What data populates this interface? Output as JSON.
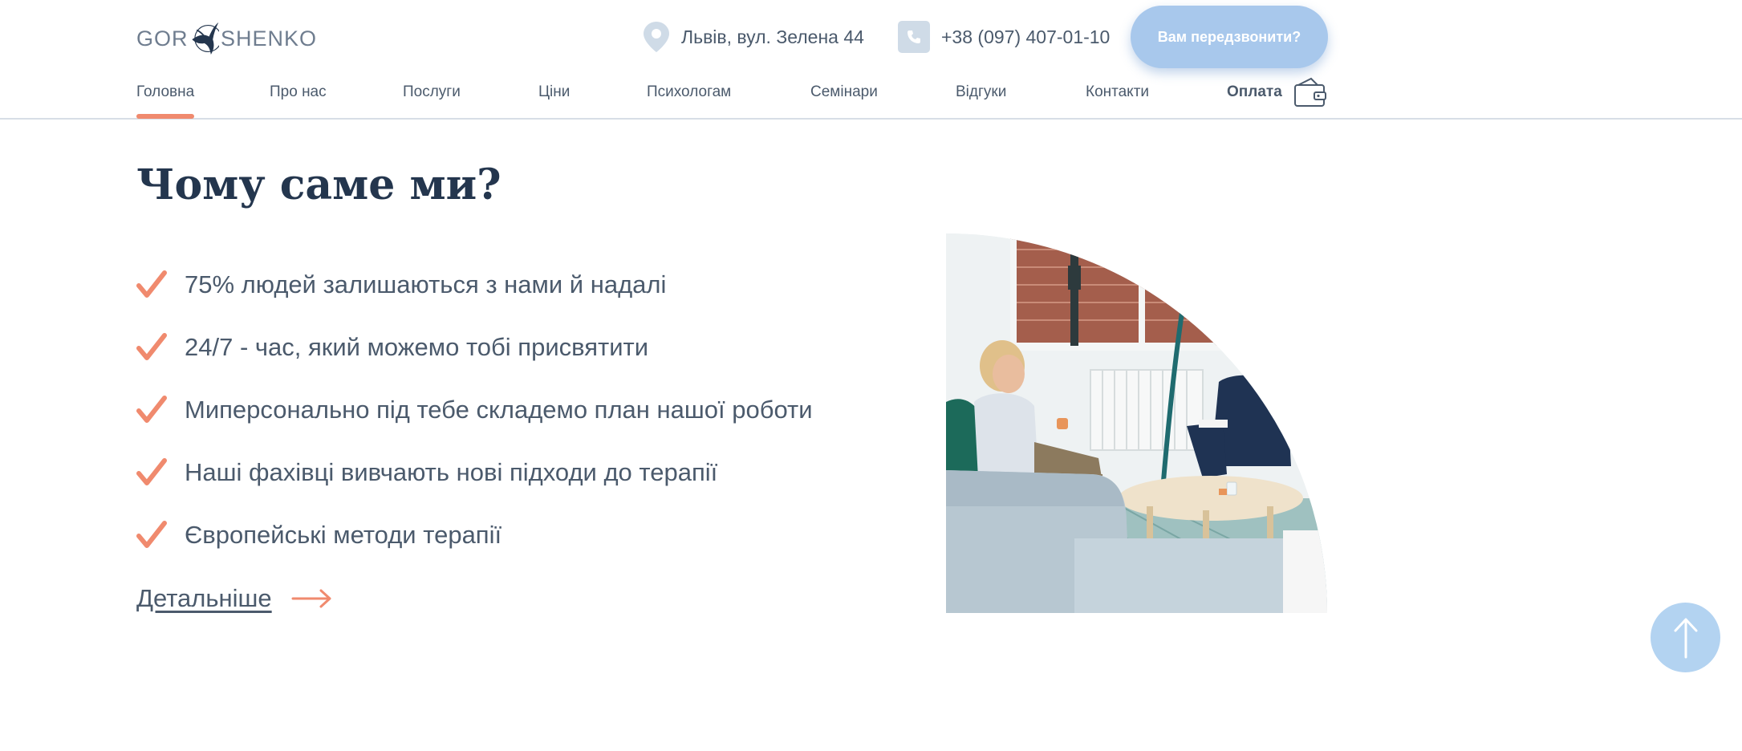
{
  "header": {
    "logo": {
      "left": "GOR",
      "right": "SHENKO"
    },
    "address": "Львів, вул. Зелена 44",
    "phone": "+38 (097) 407-01-10",
    "callback_label": "Вам передзвонити?",
    "nav": [
      {
        "label": "Головна",
        "active": true
      },
      {
        "label": "Про нас"
      },
      {
        "label": "Послуги"
      },
      {
        "label": "Ціни"
      },
      {
        "label": "Психологам"
      },
      {
        "label": "Семінари"
      },
      {
        "label": "Відгуки"
      },
      {
        "label": "Контакти"
      }
    ],
    "pay_label": "Оплата"
  },
  "main": {
    "title": "Чому саме ми?",
    "features": [
      "75% людей залишаються з нами й надалі",
      "24/7 - час, який можемо тобі присвятити",
      "Миперсонально під тебе складемо план нашої роботи",
      "Наші фахівці вивчають нові підходи до терапії",
      "Європейські методи терапії"
    ],
    "more_label": "Детальніше"
  },
  "colors": {
    "accent": "#f08a6e",
    "brand_dark": "#24364e",
    "button_blue": "#a8c8ec",
    "text": "#4b5a6c"
  },
  "icons": {
    "address": "location-pin-icon",
    "phone": "phone-icon",
    "pay": "wallet-icon",
    "check": "check-icon",
    "more": "arrow-right-icon",
    "scroll_top": "arrow-up-icon"
  }
}
